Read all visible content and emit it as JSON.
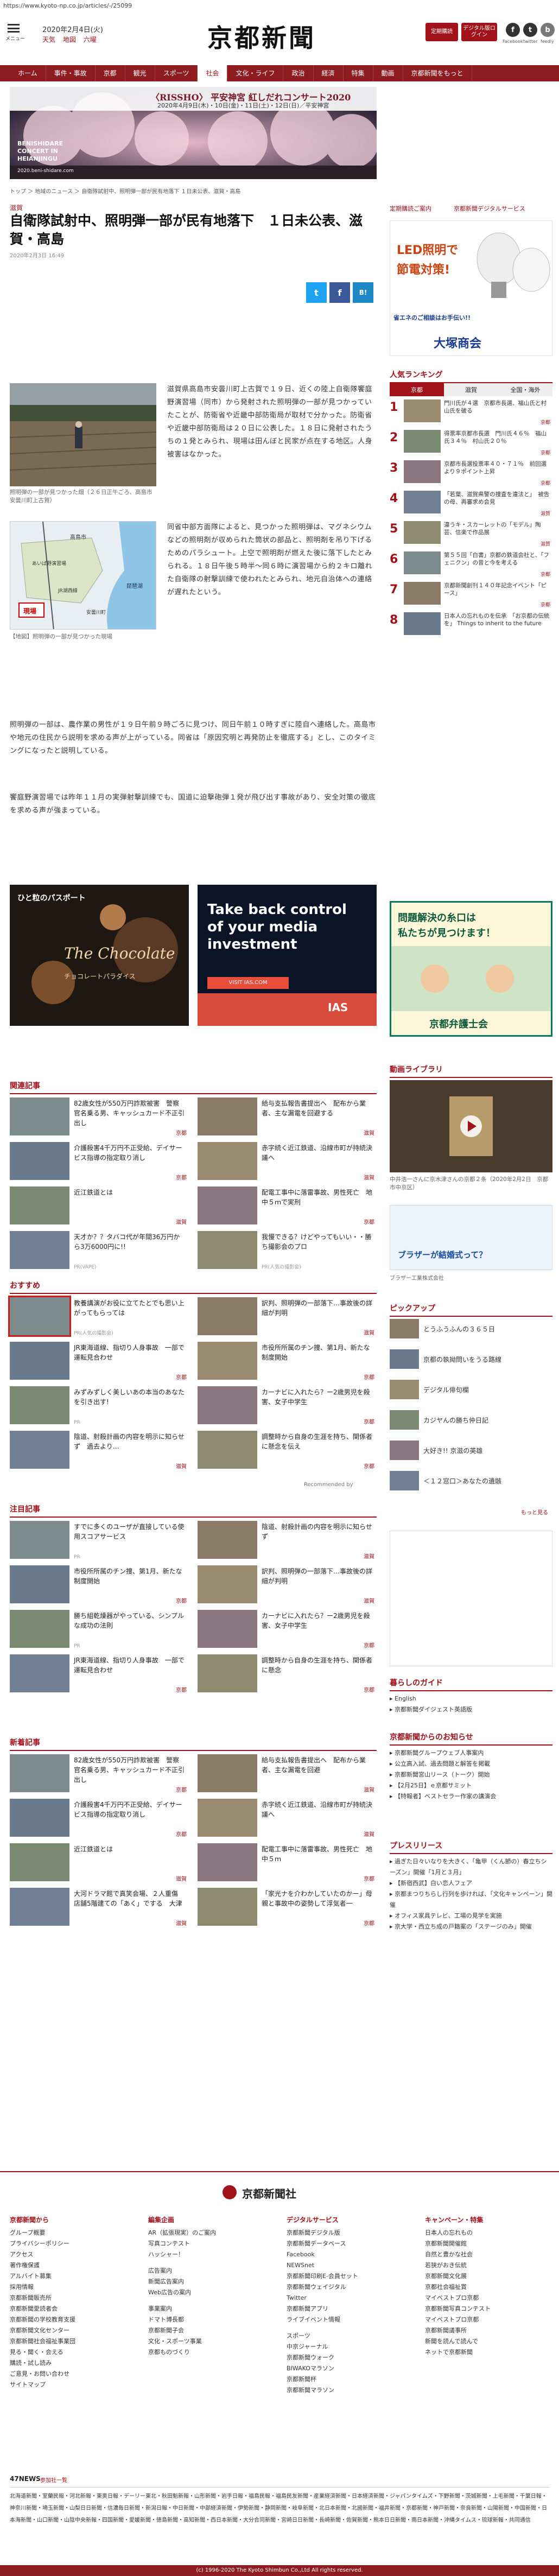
{
  "url": "https://www.kyoto-np.co.jp/articles/-/25099",
  "header": {
    "menu_label": "メニュー",
    "date": "2020年2月4日(火)",
    "weather": [
      "天気",
      "地図",
      "六曜"
    ],
    "logo": "京都新聞",
    "btn_paper": "定期購読",
    "btn_digital": "デジタル版ログイン",
    "sns": [
      {
        "icon": "f",
        "label": "Facebook"
      },
      {
        "icon": "t",
        "label": "twitter"
      },
      {
        "icon": "b",
        "label": "feedly"
      }
    ]
  },
  "nav": [
    "ホーム",
    "事件・事故",
    "京都",
    "観光",
    "スポーツ",
    "社会",
    "文化・ライフ",
    "政治",
    "経済",
    "特集",
    "動画",
    "京都新聞をもっと"
  ],
  "nav_active": 5,
  "banner": {
    "tag": "〈RISSHO〉 平安神宮 紅しだれコンサート2020",
    "dates": "2020年4月9日(木)・10日(金)・11日(土)・12日(日)／平安神宮",
    "sub": "BENISHIDARE CONCERT IN HEIANJINGU",
    "url": "2020.beni-shidare.com"
  },
  "breadcrumb": "トップ ＞ 地域のニュース ＞ 自衛隊試射中、照明弾一部が民有地落下 １日未公表、滋賀・高島",
  "article": {
    "category": "滋賀",
    "title": "自衛隊試射中、照明弾一部が民有地落下　１日未公表、滋賀・高島",
    "date": "2020年2月3日 16:49",
    "share": [
      "t",
      "f",
      "B!"
    ],
    "img1_cap": "照明弾の一部が見つかった畑（２６日正午ごろ、高島市安曇川町上古賀）",
    "img2_cap": "【地図】照明弾の一部が見つかった現場",
    "map_labels": [
      "琵琶湖",
      "あいば野演習場",
      "高島市",
      "現場",
      "JR湖西線",
      "安曇川町"
    ],
    "p1": "滋賀県高島市安曇川町上古賀で１９日、近くの陸上自衛隊饗庭野演習場（同市）から発射された照明弾の一部が見つかっていたことが、防衛省や近畿中部防衛局が取材で分かった。防衛省や近畿中部防衛局は２０日に公表した。１８日に発射されたうちの１発とみられ、現場は田んぼと民家が点在する地区。人身被害はなかった。",
    "p2": "同省中部方面隊によると、見つかった照明弾は、マグネシウムなどの照明剤が収められた筒状の部品と、照明剤を吊り下げるためのパラシュート。上空で照明剤が燃えた後に落下したとみられる。１８日午後５時半〜同６時に演習場から約２キロ離れた自衛隊の射撃訓練で使われたとみられ、地元自治体への連絡が遅れたという。",
    "p3": "照明弾の一部は、農作業の男性が１９日午前９時ごろに見つけ、同日午前１０時すぎに陸自へ連絡した。高島市や地元の住民から説明を求める声が上がっている。同省は「原因究明と再発防止を徹底する」とし、このタイミングになったと説明している。",
    "p4": "饗庭野演習場では昨年１１月の実弾射撃訓練でも、国道に迫撃砲弾１発が飛び出す事故があり、安全対策の徹底を求める声が強まっている。"
  },
  "ads": {
    "led_line1": "LED照明で",
    "led_line2": "節電対策!",
    "led_line3": "省エネのご相談はお手伝い!!",
    "led_company": "大塚商会",
    "inside1_title": "ひと粒のパスポート",
    "inside1_sub": "チョコレートパラダイス",
    "inside1_brand": "The Chocolate",
    "inside2_title": "Take back control of your media investment",
    "inside2_url": "VISIT IAS.COM",
    "inside2_logo": "IAS",
    "bengo_line1": "問題解決の糸口は",
    "bengo_line2": "私たちが見つけます！",
    "bengo_name": "京都弁護士会"
  },
  "side": {
    "pr_links": [
      "定期購読ご案内",
      "京都新聞デジタルサービス"
    ],
    "ranking_head": "人気ランキング",
    "rank_tabs": [
      "京都",
      "滋賀",
      "全国・海外"
    ],
    "ranking": [
      {
        "title": "門川氏が４選　京都市長選、福山氏と村山氏を破る",
        "tag": "京都"
      },
      {
        "title": "得票率京都市長選　門川氏４６％　福山氏３４％　村山氏２０％",
        "tag": "京都"
      },
      {
        "title": "京都市長選投票率４０・７１％　前回選より９ポイント上昇",
        "tag": "京都"
      },
      {
        "title": "「若葉、滋賀県警の捜査を違法と」　被告の母、再審求め会見",
        "tag": "滋賀"
      },
      {
        "title": "違うキ・スカーレットの「モデル」陶芸、信楽で作品展",
        "tag": "滋賀"
      },
      {
        "title": "第５５回「白書」京都の鉄道会社と、「フェニクン」の昔と今を考える",
        "tag": "京都"
      },
      {
        "title": "京都新聞創刊１４０年記念イベント「ピース」",
        "tag": "京都"
      },
      {
        "title": "日本人の忘れものを伝承　「お京都の伝統を」 Things to inherit to the future",
        "tag": ""
      }
    ],
    "video_head": "動画ライブラリ",
    "video_cap": "中井浩一さんに京木津さんの京都２条（2020年2月2日　京都市中京区）",
    "brother_label": "ブラザーが結婚式って？",
    "brother_sub": "ブラザー工業株式会社",
    "pickup_head": "ピックアップ",
    "pickup": [
      "とうふうふんの３６５日",
      "京都の執拗問いをうる路線",
      "デジタル俳句欄",
      "カジヤんの勝ち仲日記",
      "大好き!! 京滋の英雄",
      "＜１２窓口＞あなたの遺骸"
    ],
    "pickup_more": "もっと見る",
    "life_head": "暮らしのガイド",
    "life": [
      "English",
      "京都新聞ダイジェスト英語版"
    ],
    "notice_head": "京都新聞からのお知らせ",
    "notice": [
      "京都新聞グループウェブ人事案内",
      "公立高入試、過去問題と解答を掲載",
      "京都新聞宮山リース（トーク）開始",
      "【2月25日】ｅ京都サミット",
      "【特報者】ベストセラー作家の講演会"
    ],
    "press_head": "プレスリリース",
    "press": [
      "過ぎた日々いなりを大きく、「亀甲（くん節の）春立ちシーズン」開催「1月と３月」",
      "【新宿西武】白い恋人フェア",
      "京都まつりちらし行列を歩ければ、「文化キャンペーン」開催",
      "オフィス家具テレビ、工場の見学を実施",
      "京大学・西立ち成の戸籍案の「ステージのみ」開催"
    ]
  },
  "related_head": "関連記事",
  "related": [
    {
      "title": "82歳女性が550万円詐欺被害　警察官名乗る男、キャッシュカード不正引出し",
      "tag": "京都"
    },
    {
      "title": "給与支払報告書提出へ　配布から業者、主な漏電を回避する",
      "tag": "滋賀"
    },
    {
      "title": "介護殺害4千万円不正受給、デイサービス指導の指定取り消し",
      "tag": "京都"
    },
    {
      "title": "赤字続く近江鉄道、沿線市町が持続決議へ",
      "tag": "滋賀"
    },
    {
      "title": "近江鉄道とは",
      "tag": "滋賀"
    },
    {
      "title": "配電工事中に落雷事故、男性死亡　地中５ｍで実刑",
      "tag": "京都"
    },
    {
      "title": "天才か？？タバコ代が年間36万円から3万6000円に!!",
      "tag": "PR(VAPE)"
    },
    {
      "title": "我慢できる？けどやってもいい・・勝ち撮影会のプロ",
      "tag": "PR(人気の撮影会)"
    }
  ],
  "osusume_head": "おすすめ",
  "osusume": [
    {
      "title": "教養講演がお役に立てたとでも思い上がってもらっては",
      "tag": "PR(人気の撮影会)"
    },
    {
      "title": "訳判、照明弾の一部落下…事故後の詳細が判明",
      "tag": "滋賀"
    },
    {
      "title": "JR東海道線、指切り人身事故　一部で運転見合わせ",
      "tag": "京都"
    },
    {
      "title": "市役所所属のチン捜、第1月、新たな制度開始",
      "tag": "京都"
    },
    {
      "title": "みずみずしく美しいあの本当のあなたを引き出す!",
      "tag": "PR"
    },
    {
      "title": "カーナビに入れたら？ー2歳男児を殺害、女子中学生",
      "tag": "京都"
    },
    {
      "title": "陰道、射殺計画の内容を明示に知らせず　過去より…",
      "tag": "滋賀"
    },
    {
      "title": "調整時から自身の生涯を持ち、関係者に懸念を伝え",
      "tag": "京都"
    }
  ],
  "recommend_by": "Recommended by",
  "chuumoku_head": "注目記事",
  "chuumoku": [
    {
      "title": "すでに多くのユーザが直接している使用スコアサービス",
      "tag": "PR"
    },
    {
      "title": "陰道、射殺計画の内容を明示に知らせず",
      "tag": "滋賀"
    },
    {
      "title": "市役所所属のチン捜、第1月、新たな制度開始",
      "tag": "京都"
    },
    {
      "title": "訳判、照明弾の一部落下…事故後の詳細が判明",
      "tag": "滋賀"
    },
    {
      "title": "勝ち組乾燥器がやっている、シンプルな成功の法則",
      "tag": "PR"
    },
    {
      "title": "カーナビに入れたら？ー2歳男児を殺害、女子中学生",
      "tag": "京都"
    },
    {
      "title": "JR東海道線、指切り人身事故　一部で運転見合わせ",
      "tag": "京都"
    },
    {
      "title": "調整時から自身の生涯を持ち、関係者に懸念",
      "tag": "京都"
    }
  ],
  "shinchaku_head": "新着記事",
  "shinchaku": [
    {
      "title": "82歳女性が550万円詐欺被害　警察官名乗る男、キャッシュカード不正引出し",
      "tag": "京都"
    },
    {
      "title": "給与支払報告書提出へ　配布から業者、主な漏電を回避",
      "tag": "滋賀"
    },
    {
      "title": "介護殺害4千万円不正受給、デイサービス指導の指定取り消し",
      "tag": "京都"
    },
    {
      "title": "赤字続く近江鉄道、沿線市町が持続決議へ",
      "tag": "滋賀"
    },
    {
      "title": "近江鉄道とは",
      "tag": "滋賀"
    },
    {
      "title": "配電工事中に落雷事故、男性死亡　地中５ｍ",
      "tag": "京都"
    },
    {
      "title": "大河ドラマ館で真笑会場、２人重傷　店舗5階建ての「あく」でする　大津",
      "tag": "滋賀"
    },
    {
      "title": "「家光ナを介わかしていたのかー」母親と事故中の姿勢して浮気者一",
      "tag": "京都"
    }
  ],
  "footer_logo": "京都新聞社",
  "footer_cols": [
    {
      "head": "京都新聞から",
      "items": [
        "グループ概要",
        "プライバシーポリシー",
        "アクセス",
        "著作権保護",
        "アルバイト募集",
        "採用情報",
        "京都新聞販売所",
        "京都新聞愛読者会",
        "京都新聞の学校教育支援",
        "京都新聞文化センター",
        "京都新聞社会福祉事業団",
        "見る・聞く・会える",
        "購読・試し読み",
        "ご意見・お問い合わせ",
        "サイトマップ"
      ]
    },
    {
      "head": "編集企画",
      "items": [
        "AR（拡張現実）のご案内",
        "写真コンテスト",
        "ハッシャー！",
        "",
        "広告案内",
        "新聞広告案内",
        "Web広告の案内",
        "",
        "事業案内",
        "ドマト博長都",
        "京都新聞子会",
        "文化・スポーツ事業",
        "京都ものづくり"
      ]
    },
    {
      "head": "デジタルサービス",
      "items": [
        "京都新聞デジタル版",
        "京都新聞データベース",
        "Facebook",
        "NEWSnet",
        "京都新聞印刷E-会員セット",
        "京都新聞ウェイジタル",
        "Twitter",
        "京都新聞アプリ",
        "ライブイベント情報",
        "",
        "スポーツ",
        "中京ジャーナル",
        "京都新聞ウォーク",
        "BIWAKOマラソン",
        "京都新聞杯",
        "京都新聞マラソン"
      ]
    },
    {
      "head": "キャンペーン・特集",
      "items": [
        "日本人の忘れもの",
        "京都新聞開催館",
        "自然と豊かな社会",
        "若狭がおき伝統",
        "京都新聞文化展",
        "京都社会福祉賞",
        "マイベストプロ京都",
        "京都新聞写真コンテスト",
        "マイベストプロ京都",
        "京都新聞議事所",
        "新聞を読んで読んで",
        "ネットで京都新聞"
      ]
    }
  ],
  "fourtynews": "47NEWS",
  "fourtynews_label": "参加社一覧",
  "fourtynews_members": "北海道新聞・室蘭民報・河北新報・東奥日報・デーリー東北・秋田魁新報・山形新聞・岩手日報・福島民報・福島民友新聞・産業経済新聞・日本経済新聞・ジャパンタイムズ・下野新聞・茨城新聞・上毛新聞・千葉日報・神奈川新聞・埼玉新聞・山梨日日新聞・信濃毎日新聞・新潟日報・中日新聞・中部経済新聞・伊勢新聞・静岡新聞・岐阜新聞・北日本新聞・北國新聞・福井新聞・京都新聞・神戸新聞・奈良新聞・山陽新聞・中国新聞・日本海新聞・山口新聞・山陰中央新報・四国新聞・愛媛新聞・徳島新聞・高知新聞・西日本新聞・大分合同新聞・宮崎日日新聞・長崎新聞・佐賀新聞・熊本日日新聞・南日本新聞・沖縄タイムス・琉球新報・共同通信",
  "copyright": "(c) 1996-2020 The Kyoto Shimbun Co.,Ltd All rights reserved."
}
